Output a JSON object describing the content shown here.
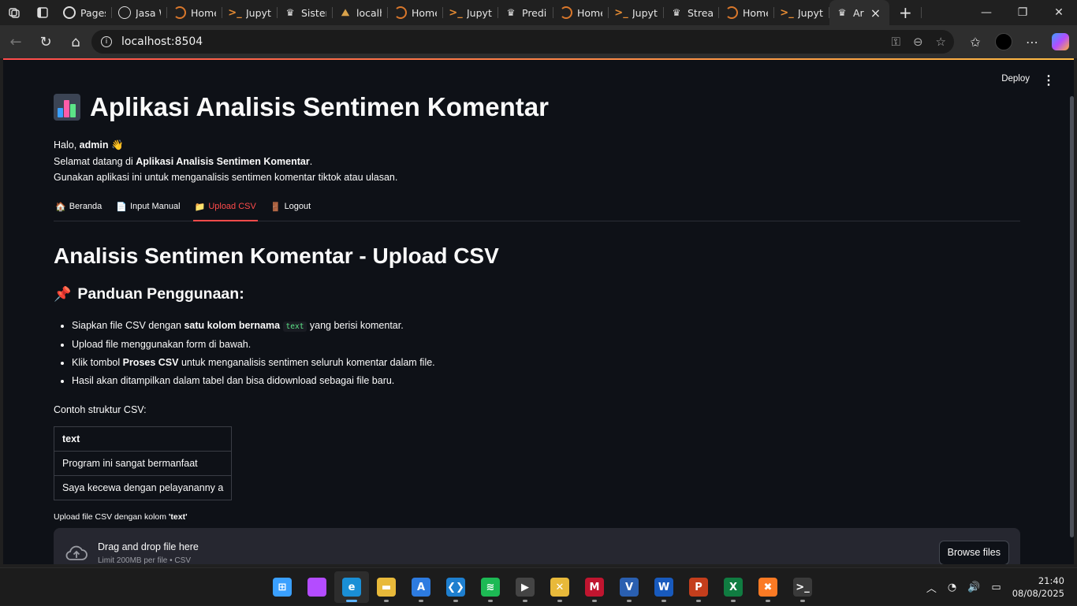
{
  "browser": {
    "tabs": [
      {
        "label": "Pages",
        "icon": "github-icon",
        "fav": "gh"
      },
      {
        "label": "Jasa W",
        "icon": "globe-icon",
        "fav": "globe"
      },
      {
        "label": "Home",
        "icon": "home-spinner-icon",
        "fav": "home"
      },
      {
        "label": "Jupyte",
        "icon": "jupyter-icon",
        "fav": "jup"
      },
      {
        "label": "Sistem",
        "icon": "streamlit-crown-icon",
        "fav": "crown"
      },
      {
        "label": "localhc",
        "icon": "mountain-icon",
        "fav": "mtn"
      },
      {
        "label": "Home",
        "icon": "home-spinner-icon",
        "fav": "home"
      },
      {
        "label": "Jupyte",
        "icon": "jupyter-icon",
        "fav": "jup"
      },
      {
        "label": "Prediks",
        "icon": "streamlit-crown-icon",
        "fav": "crown"
      },
      {
        "label": "Home",
        "icon": "home-spinner-icon",
        "fav": "home"
      },
      {
        "label": "Jupyte",
        "icon": "jupyter-icon",
        "fav": "jup"
      },
      {
        "label": "Stream",
        "icon": "streamlit-crown-icon",
        "fav": "crown"
      },
      {
        "label": "Home",
        "icon": "home-spinner-icon",
        "fav": "home"
      },
      {
        "label": "Jupyte",
        "icon": "jupyter-icon",
        "fav": "jup"
      },
      {
        "label": "Ar",
        "icon": "streamlit-crown-icon",
        "fav": "crown",
        "active": true
      }
    ],
    "url": "localhost:8504"
  },
  "app": {
    "deploy_label": "Deploy",
    "title": "Aplikasi Analisis Sentimen Komentar",
    "greeting_prefix": "Halo, ",
    "username": "admin",
    "wave": "👋",
    "welcome_prefix": "Selamat datang di ",
    "welcome_app": "Aplikasi Analisis Sentimen Komentar",
    "welcome_suffix": ".",
    "description": "Gunakan aplikasi ini untuk menganalisis sentimen komentar tiktok atau ulasan.",
    "nav": [
      {
        "icon": "🏠",
        "label": "Beranda",
        "name": "tab-beranda"
      },
      {
        "icon": "📄",
        "label": "Input Manual",
        "name": "tab-input-manual"
      },
      {
        "icon": "📁",
        "label": "Upload CSV",
        "name": "tab-upload-csv",
        "active": true
      },
      {
        "icon": "🚪",
        "label": "Logout",
        "name": "tab-logout"
      }
    ],
    "page_heading": "Analisis Sentimen Komentar - Upload CSV",
    "guide_heading": "Panduan Penggunaan:",
    "guide": {
      "item1_pre": "Siapkan file CSV dengan ",
      "item1_bold": "satu kolom bernama",
      "item1_code": "text",
      "item1_post": " yang berisi komentar.",
      "item2": "Upload file menggunakan form di bawah.",
      "item3_pre": "Klik tombol ",
      "item3_bold": "Proses CSV",
      "item3_post": " untuk menganalisis sentimen seluruh komentar dalam file.",
      "item4": "Hasil akan ditampilkan dalam tabel dan bisa didownload sebagai file baru."
    },
    "example_label": "Contoh struktur CSV:",
    "example_table": {
      "header": "text",
      "rows": [
        "Program ini sangat bermanfaat",
        "Saya kecewa dengan pelayananny a"
      ]
    },
    "upload_label_pre": "Upload file CSV dengan kolom ",
    "upload_label_bold": "'text'",
    "dropzone_title": "Drag and drop file here",
    "dropzone_hint": "Limit 200MB per file • CSV",
    "browse_label": "Browse files"
  },
  "taskbar": {
    "time": "21:40",
    "date": "08/08/2025",
    "apps": [
      {
        "name": "start-button",
        "glyph": "⊞",
        "color": "#3aa0ff"
      },
      {
        "name": "copilot-app",
        "glyph": "",
        "color": "#b44cff"
      },
      {
        "name": "edge-app",
        "glyph": "e",
        "color": "#1a8fd6",
        "active": true
      },
      {
        "name": "file-explorer-app",
        "glyph": "▬",
        "color": "#e8b93a"
      },
      {
        "name": "jetbrains-app",
        "glyph": "A",
        "color": "#2d7be0"
      },
      {
        "name": "vscode-app",
        "glyph": "❮❯",
        "color": "#1e7fcf"
      },
      {
        "name": "spotify-app",
        "glyph": "≋",
        "color": "#1db954"
      },
      {
        "name": "media-player-app",
        "glyph": "▶",
        "color": "#444"
      },
      {
        "name": "git-tool-app",
        "glyph": "✕",
        "color": "#e8b93a"
      },
      {
        "name": "mendeley-app",
        "glyph": "M",
        "color": "#c0152f"
      },
      {
        "name": "vm-app",
        "glyph": "V",
        "color": "#2a5fb0"
      },
      {
        "name": "word-app",
        "glyph": "W",
        "color": "#185abd"
      },
      {
        "name": "powerpoint-app",
        "glyph": "P",
        "color": "#c43e1c"
      },
      {
        "name": "excel-app",
        "glyph": "X",
        "color": "#107c41"
      },
      {
        "name": "xampp-app",
        "glyph": "✖",
        "color": "#fb7a24"
      },
      {
        "name": "terminal-app",
        "glyph": ">_",
        "color": "#3a3a3a"
      }
    ]
  }
}
